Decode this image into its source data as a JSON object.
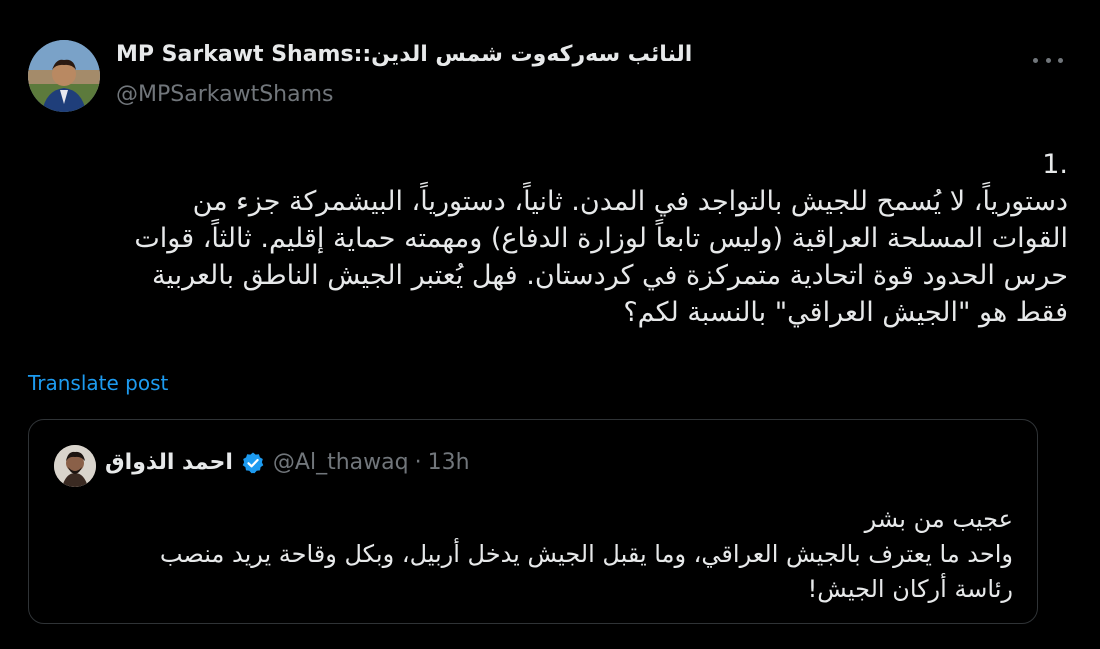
{
  "author": {
    "display_name": "MP Sarkawt Shams::النائب سەرکەوت شمس الدين",
    "handle": "@MPSarkawtShams"
  },
  "tweet": {
    "number": "1.",
    "lines": [
      "دستورياً، لا يُسمح للجيش بالتواجد في المدن. ثانياً، دستورياً، البيشمركة جزء من",
      "القوات المسلحة العراقية (وليس تابعاً لوزارة الدفاع) ومهمته حماية إقليم. ثالثاً، قوات",
      "حرس الحدود قوة اتحادية متمركزة في كردستان. فهل يُعتبر الجيش الناطق بالعربية",
      "فقط هو \"الجيش العراقي\" بالنسبة لكم؟"
    ]
  },
  "translate_label": "Translate post",
  "quoted": {
    "display_name": "احمد الذواق",
    "handle": "@Al_thawaq",
    "separator": "·",
    "time": "13h",
    "lines": [
      "عجيب من بشر",
      "واحد ما يعترف بالجيش العراقي، وما يقبل الجيش يدخل أربيل، وبكل وقاحة يريد منصب",
      "رئاسة أركان الجيش!"
    ]
  },
  "colors": {
    "background": "#000000",
    "text": "#e7e9ea",
    "muted": "#71767b",
    "accent": "#1d9bf0",
    "border": "#2f3336"
  },
  "icons": [
    "more-icon",
    "verified-badge-icon"
  ]
}
